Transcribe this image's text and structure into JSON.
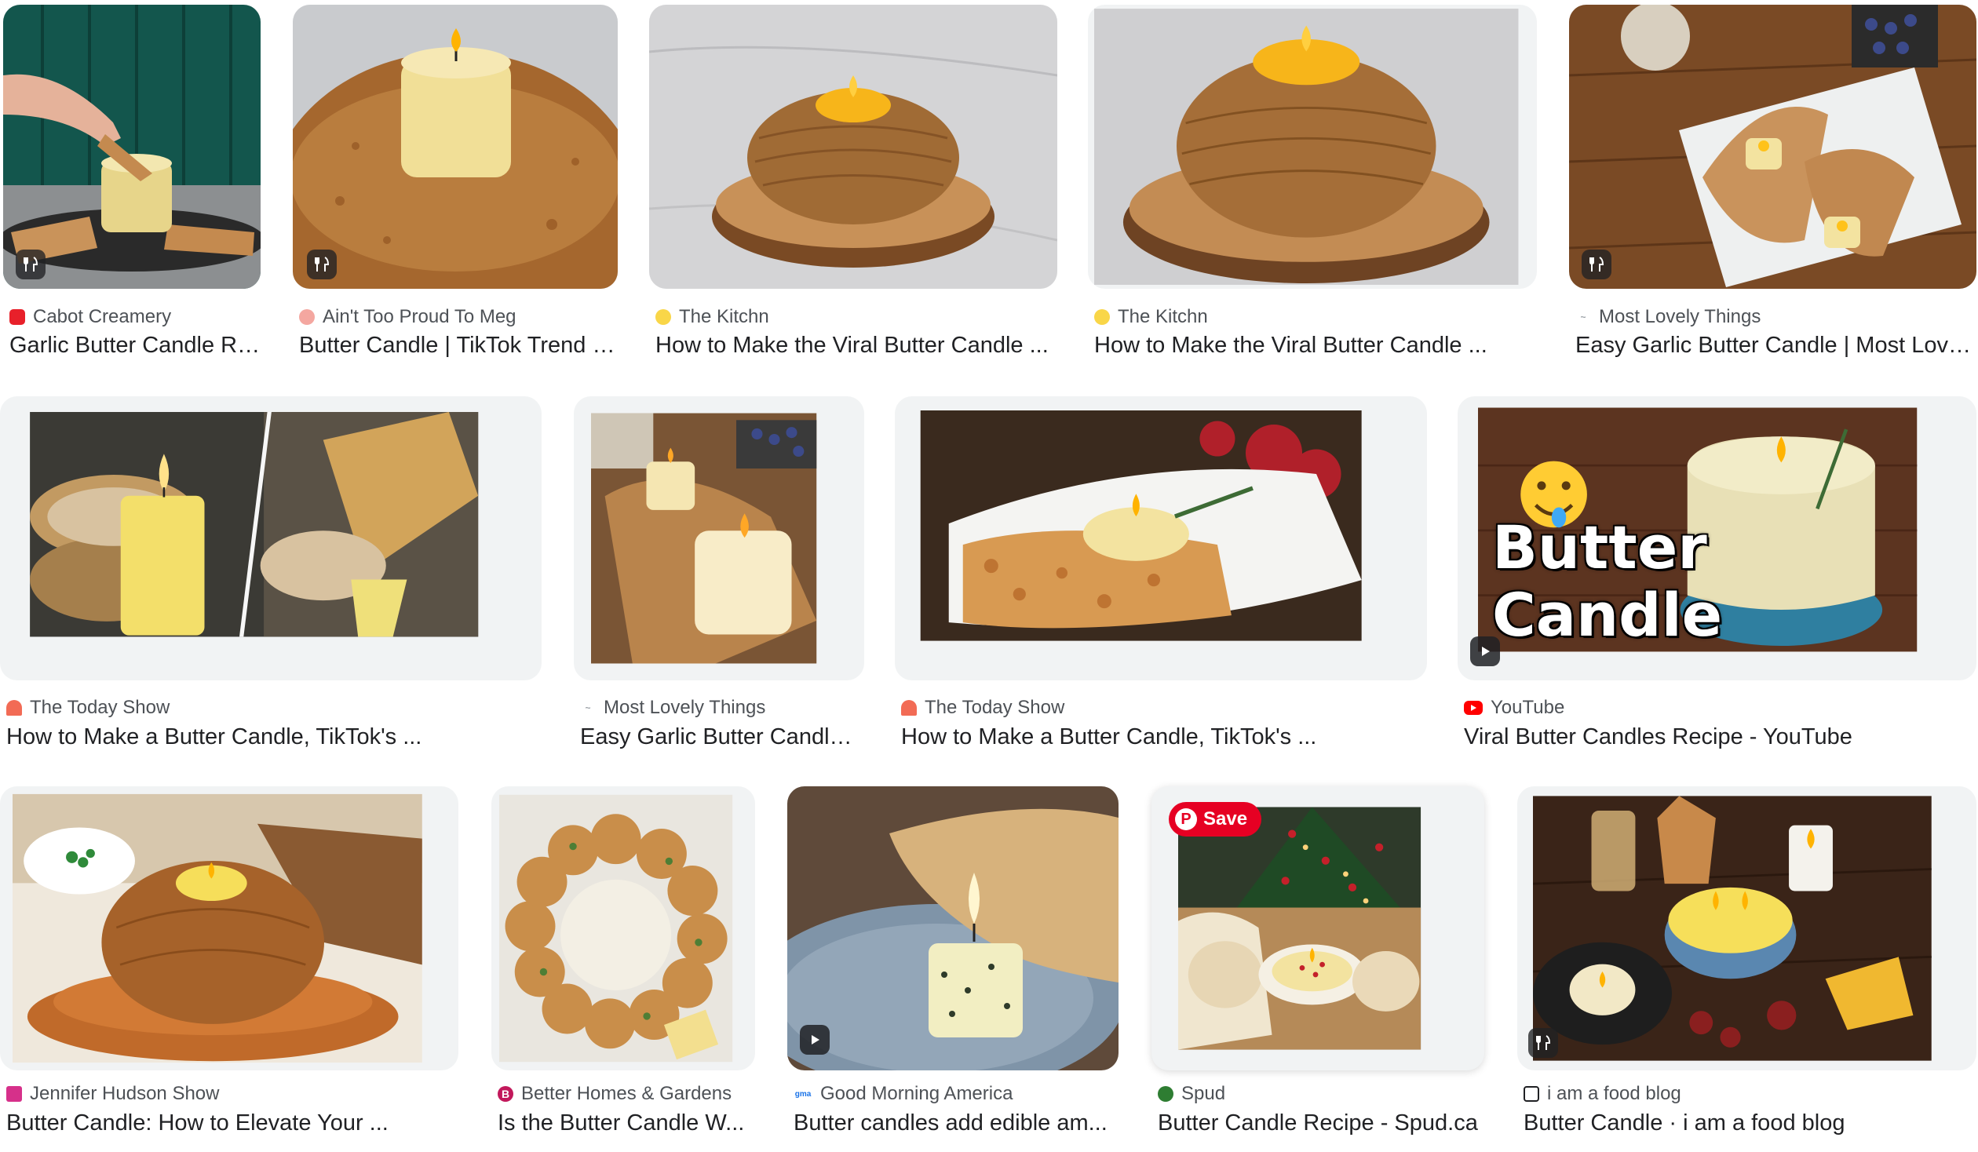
{
  "results": [
    {
      "source": "Cabot Creamery",
      "title": "Garlic Butter Candle Re...",
      "favicon_color": "#e8202a",
      "favicon_glyph": "",
      "badge": "recipe-icon"
    },
    {
      "source": "Ain't Too Proud To Meg",
      "title": "Butter Candle | TikTok Trend |...",
      "favicon_color": "#f4a7a0",
      "favicon_glyph": "",
      "badge": "recipe-icon"
    },
    {
      "source": "The Kitchn",
      "title": "How to Make the Viral Butter Candle ...",
      "favicon_color": "#f9d648",
      "favicon_glyph": "",
      "badge": ""
    },
    {
      "source": "The Kitchn",
      "title": "How to Make the Viral Butter Candle ...",
      "favicon_color": "#f9d648",
      "favicon_glyph": "",
      "badge": ""
    },
    {
      "source": "Most Lovely Things",
      "title": "Easy Garlic Butter Candle | Most Love...",
      "favicon_color": "#9aa0a6",
      "favicon_glyph": "",
      "badge": "recipe-icon"
    },
    {
      "source": "The Today Show",
      "title": "How to Make a Butter Candle, TikTok's ...",
      "favicon_color": "#f26b55",
      "favicon_glyph": "",
      "badge": ""
    },
    {
      "source": "Most Lovely Things",
      "title": "Easy Garlic Butter Candle ...",
      "favicon_color": "#9aa0a6",
      "favicon_glyph": "",
      "badge": ""
    },
    {
      "source": "The Today Show",
      "title": "How to Make a Butter Candle, TikTok's ...",
      "favicon_color": "#f26b55",
      "favicon_glyph": "",
      "badge": ""
    },
    {
      "source": "YouTube",
      "title": "Viral Butter Candles Recipe - YouTube",
      "favicon_color": "#ff0000",
      "favicon_glyph": "",
      "badge": "play-icon",
      "overlay_lines": [
        "Butter",
        "Candle"
      ]
    },
    {
      "source": "Jennifer Hudson Show",
      "title": "Butter Candle: How to Elevate Your ...",
      "favicon_color": "#d6308a",
      "favicon_glyph": "",
      "badge": ""
    },
    {
      "source": "Better Homes & Gardens",
      "title": "Is the Butter Candle W...",
      "favicon_color": "#c2185b",
      "favicon_glyph": "B",
      "badge": ""
    },
    {
      "source": "Good Morning America",
      "title": "Butter candles add edible am...",
      "favicon_color": "#1a73e8",
      "favicon_glyph": "",
      "badge": "play-icon"
    },
    {
      "source": "Spud",
      "title": "Butter Candle Recipe - Spud.ca",
      "favicon_color": "#2e7d32",
      "favicon_glyph": "",
      "badge": "",
      "save_label": "Save"
    },
    {
      "source": "i am a food blog",
      "title": "Butter Candle · i am a food blog",
      "favicon_color": "#202124",
      "favicon_glyph": "",
      "badge": "recipe-icon"
    }
  ],
  "colors": {
    "candle": "#f3e3a0",
    "flame": "#ffb300",
    "bread": "#b5743a",
    "wood": "#6d4526"
  }
}
